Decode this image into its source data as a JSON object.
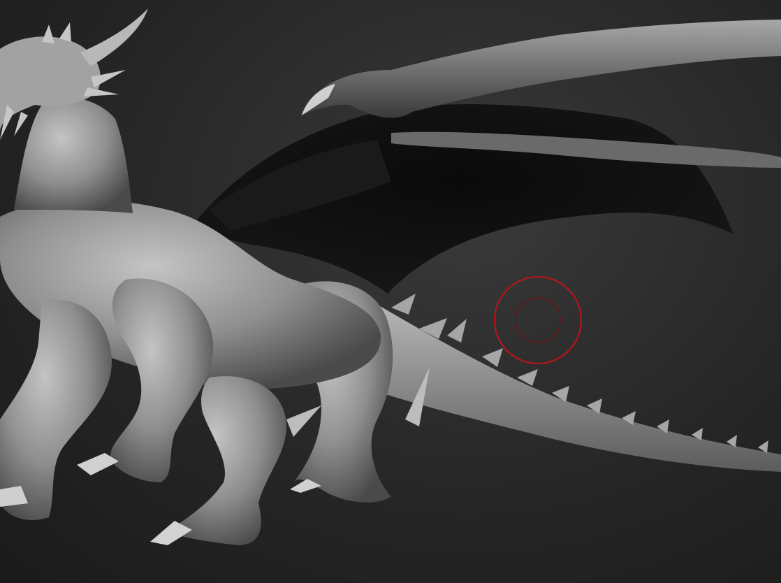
{
  "viewport": {
    "background_color": "#2a2a2a",
    "model_material_color": "#9a9a9a",
    "model_shadow_color": "#3c3c3c",
    "wing_membrane_color": "#0e0e0e"
  },
  "brush_cursor": {
    "outer_ring_color": "#c0141a",
    "inner_ring_color": "#6e1014"
  }
}
